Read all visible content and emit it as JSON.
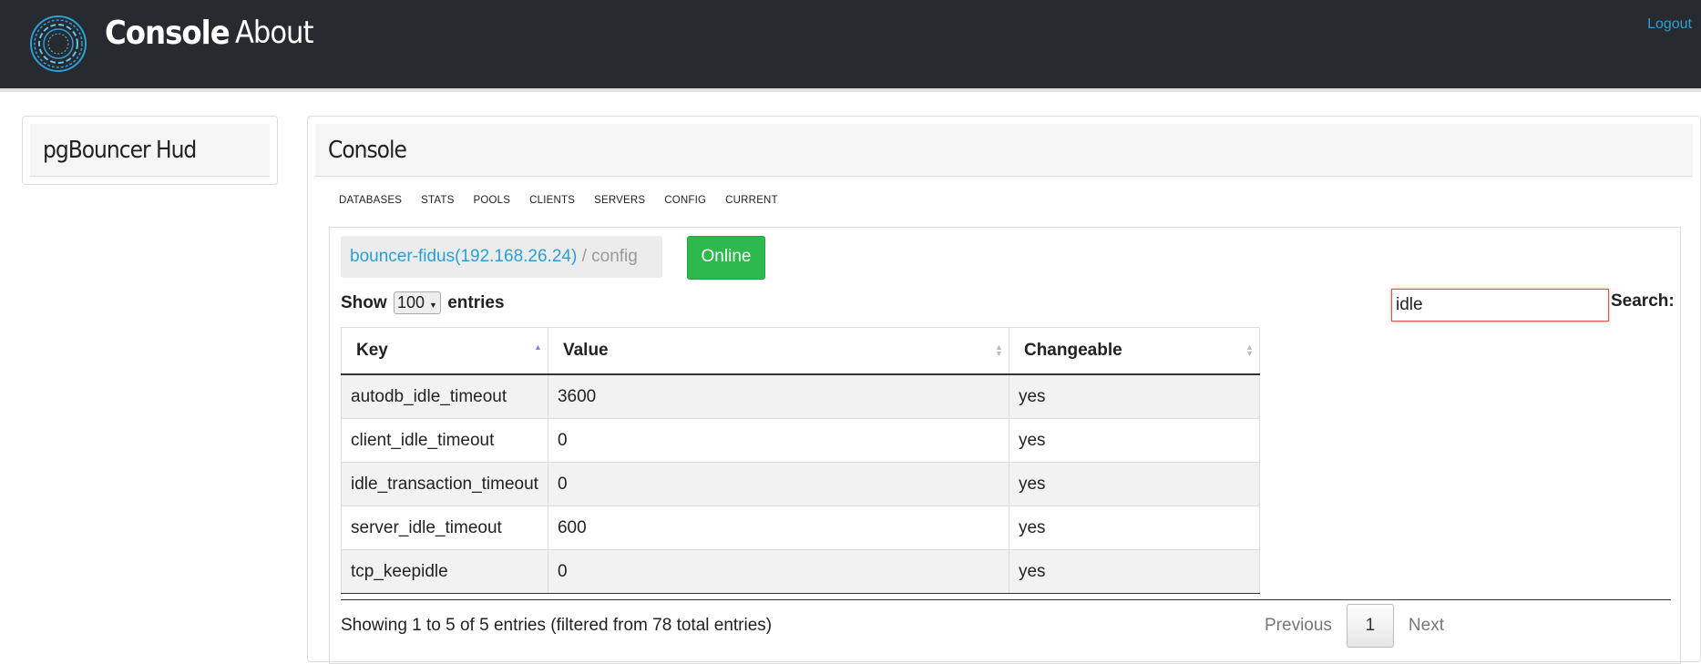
{
  "navbar": {
    "brand": "Console",
    "about": "About",
    "logout": "Logout"
  },
  "sidebar": {
    "title": "pgBouncer Hud"
  },
  "main": {
    "title": "Console",
    "tabs": [
      "DATABASES",
      "STATS",
      "POOLS",
      "CLIENTS",
      "SERVERS",
      "CONFIG",
      "CURRENT"
    ],
    "breadcrumb": {
      "server": "bouncer-fidus(192.168.26.24)",
      "separator": " / ",
      "page": "config"
    },
    "status": "Online",
    "show_label": "Show",
    "entries_value": "100",
    "entries_label": "entries",
    "search_label": "Search:",
    "search_value": "idle",
    "table": {
      "headers": [
        "Key",
        "Value",
        "Changeable"
      ],
      "rows": [
        [
          "autodb_idle_timeout",
          "3600",
          "yes"
        ],
        [
          "client_idle_timeout",
          "0",
          "yes"
        ],
        [
          "idle_transaction_timeout",
          "0",
          "yes"
        ],
        [
          "server_idle_timeout",
          "600",
          "yes"
        ],
        [
          "tcp_keepidle",
          "0",
          "yes"
        ]
      ]
    },
    "info": "Showing 1 to 5 of 5 entries (filtered from 78 total entries)",
    "pager": {
      "previous": "Previous",
      "page": "1",
      "next": "Next"
    }
  },
  "colors": {
    "navbar": "#272b30",
    "link": "#2a9fd6",
    "online": "#2db94d"
  }
}
